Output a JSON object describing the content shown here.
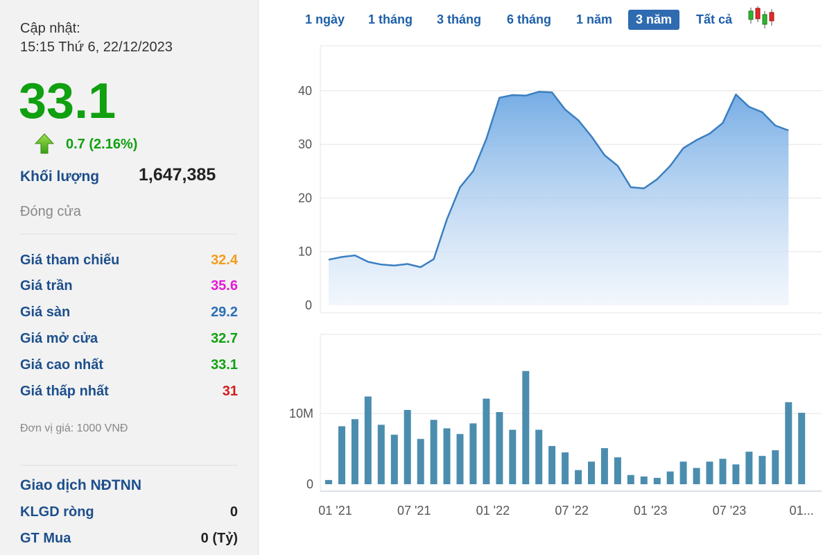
{
  "update": {
    "label": "Cập nhật:",
    "datetime": "15:15 Thứ 6, 22/12/2023"
  },
  "price": {
    "current": "33.1",
    "change": "0.7 (2.16%)",
    "color": "#10a010"
  },
  "volume": {
    "label": "Khối lượng",
    "value": "1,647,385"
  },
  "status": "Đóng cửa",
  "stats": [
    {
      "label": "Giá tham chiếu",
      "value": "32.4",
      "color": "#f39c1e"
    },
    {
      "label": "Giá trần",
      "value": "35.6",
      "color": "#e61ad6"
    },
    {
      "label": "Giá sàn",
      "value": "29.2",
      "color": "#2a6fb8"
    },
    {
      "label": "Giá mở cửa",
      "value": "32.7",
      "color": "#10a010"
    },
    {
      "label": "Giá cao nhất",
      "value": "33.1",
      "color": "#10a010"
    },
    {
      "label": "Giá thấp nhất",
      "value": "31",
      "color": "#d61a1a"
    }
  ],
  "unit_note": "Đơn vị giá: 1000 VNĐ",
  "foreign": {
    "title": "Giao dịch NĐTNN",
    "rows": [
      {
        "label": "KLGD ròng",
        "value": "0"
      },
      {
        "label": "GT Mua",
        "value": "0 (Tỷ)"
      }
    ]
  },
  "tabs": [
    "1 ngày",
    "1 tháng",
    "3 tháng",
    "6 tháng",
    "1 năm",
    "3 năm",
    "Tất cả"
  ],
  "active_tab": "3 năm",
  "icons": {
    "change": "up-arrow-icon",
    "chart_type": "candlestick-icon"
  },
  "chart_data": [
    {
      "type": "area",
      "ylim": [
        0,
        45
      ],
      "yticks": [
        0,
        10,
        20,
        30,
        40
      ],
      "ytick_labels": [
        "0",
        "10",
        "20",
        "30",
        "40"
      ],
      "x": [
        0,
        1,
        2,
        3,
        4,
        5,
        6,
        7,
        8,
        9,
        10,
        11,
        12,
        13,
        14,
        15,
        16,
        17,
        18,
        19,
        20,
        21,
        22,
        23,
        24,
        25,
        26,
        27,
        28,
        29,
        30,
        31,
        32,
        33,
        34,
        35
      ],
      "values": [
        8.5,
        9,
        9.3,
        8.1,
        7.6,
        7.4,
        7.7,
        7.1,
        8.6,
        16,
        22,
        25,
        31,
        38.7,
        39.2,
        39.1,
        39.8,
        39.7,
        36.5,
        34.5,
        31.5,
        28,
        26,
        22,
        21.8,
        23.5,
        26,
        29.3,
        30.8,
        32,
        34,
        39.3,
        37,
        36,
        33.5,
        32.6
      ],
      "color": "#3a7fc1"
    },
    {
      "type": "bar",
      "ylim": [
        0,
        16
      ],
      "yticks": [
        0,
        10
      ],
      "ytick_labels": [
        "0",
        "10M"
      ],
      "x": [
        0,
        1,
        2,
        3,
        4,
        5,
        6,
        7,
        8,
        9,
        10,
        11,
        12,
        13,
        14,
        15,
        16,
        17,
        18,
        19,
        20,
        21,
        22,
        23,
        24,
        25,
        26,
        27,
        28,
        29,
        30,
        31,
        32,
        33,
        34,
        35
      ],
      "values": [
        0.6,
        8.2,
        9.2,
        12.4,
        8.4,
        7,
        10.5,
        6.4,
        9.1,
        7.9,
        7.1,
        8.6,
        12.1,
        10.2,
        7.7,
        16,
        7.7,
        5.4,
        4.5,
        2,
        3.2,
        5.1,
        3.8,
        1.3,
        1.1,
        0.9,
        1.8,
        3.2,
        2.3,
        3.2,
        3.6,
        2.8,
        4.6,
        4,
        4.8,
        11.6,
        10.1
      ],
      "color": "#4b8dae"
    }
  ],
  "x_axis": {
    "labels": [
      "01 '21",
      "07 '21",
      "01 '22",
      "07 '22",
      "01 '23",
      "07 '23",
      "01..."
    ],
    "positions": [
      0.5,
      6.5,
      12.5,
      18.5,
      24.5,
      30.5,
      36
    ]
  }
}
